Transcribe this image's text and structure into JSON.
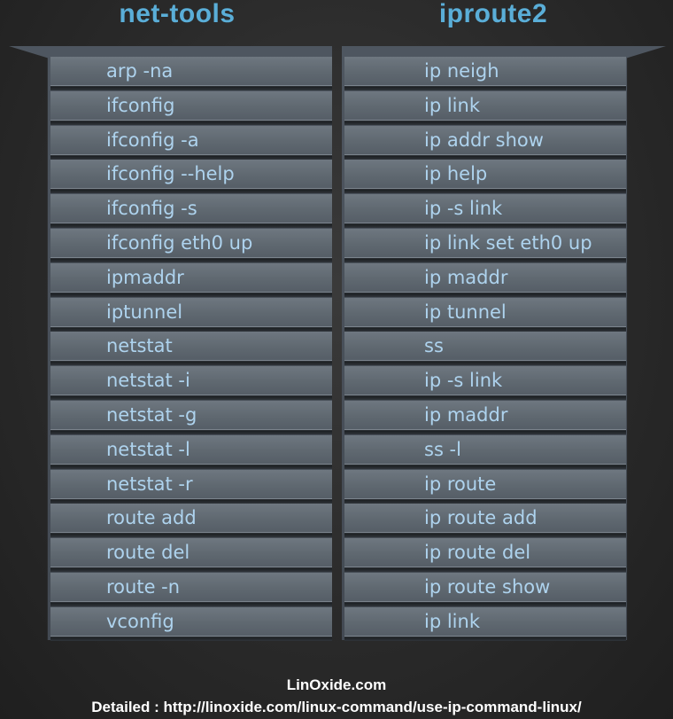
{
  "headers": {
    "left": "net-tools",
    "right": "iproute2"
  },
  "rows": [
    {
      "old": "arp -na",
      "new": "ip neigh"
    },
    {
      "old": "ifconfig",
      "new": "ip link"
    },
    {
      "old": "ifconfig -a",
      "new": "ip addr show"
    },
    {
      "old": "ifconfig --help",
      "new": "ip help"
    },
    {
      "old": "ifconfig -s",
      "new": "ip -s link"
    },
    {
      "old": "ifconfig eth0 up",
      "new": "ip link set eth0 up"
    },
    {
      "old": "ipmaddr",
      "new": "ip maddr"
    },
    {
      "old": "iptunnel",
      "new": "ip tunnel"
    },
    {
      "old": "netstat",
      "new": "ss"
    },
    {
      "old": "netstat -i",
      "new": "ip -s link"
    },
    {
      "old": "netstat  -g",
      "new": "ip maddr"
    },
    {
      "old": "netstat -l",
      "new": "ss -l"
    },
    {
      "old": "netstat -r",
      "new": "ip route"
    },
    {
      "old": "route add",
      "new": "ip route add"
    },
    {
      "old": "route del",
      "new": "ip route del"
    },
    {
      "old": "route -n",
      "new": "ip route show"
    },
    {
      "old": "vconfig",
      "new": "ip link"
    }
  ],
  "footer": {
    "site": "LinOxide.com",
    "detail": "Detailed : http://linoxide.com/linux-command/use-ip-command-linux/"
  },
  "colors": {
    "heading": "#5aaed8",
    "cell_text": "#aed3ee",
    "background": "#2a2a2a"
  }
}
